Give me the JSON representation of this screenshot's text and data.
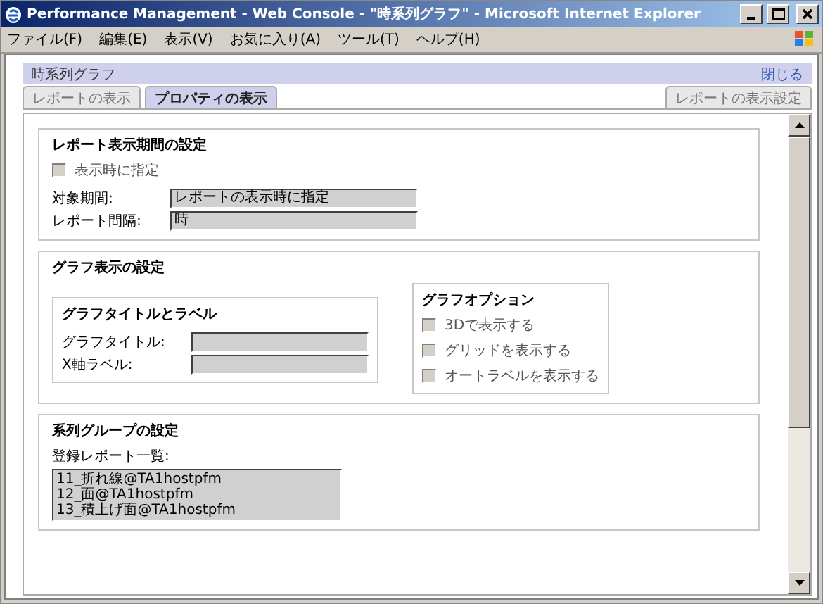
{
  "window": {
    "title": "Performance Management - Web Console - \"時系列グラフ\" - Microsoft Internet Explorer"
  },
  "menu": [
    "ファイル(F)",
    "編集(E)",
    "表示(V)",
    "お気に入り(A)",
    "ツール(T)",
    "ヘルプ(H)"
  ],
  "panel": {
    "title": "時系列グラフ",
    "close_link": "閉じる"
  },
  "tabs": [
    {
      "label": "レポートの表示",
      "selected": false
    },
    {
      "label": "プロパティの表示",
      "selected": true
    }
  ],
  "right_tab": {
    "label": "レポートの表示設定",
    "selected": false
  },
  "period_section": {
    "title": "レポート表示期間の設定",
    "checkbox": {
      "label": "表示時に指定",
      "checked": false,
      "disabled": true
    },
    "fields": [
      {
        "label": "対象期間:",
        "value": "レポートの表示時に指定",
        "disabled": true
      },
      {
        "label": "レポート間隔:",
        "value": "時",
        "disabled": true
      }
    ]
  },
  "graph_section": {
    "title": "グラフ表示の設定",
    "title_label_group": {
      "title": "グラフタイトルとラベル",
      "fields": [
        {
          "label": "グラフタイトル:",
          "disabled": true
        },
        {
          "label": "X軸ラベル:",
          "disabled": true
        }
      ]
    },
    "options_group": {
      "title": "グラフオプション",
      "options": [
        {
          "label": "3Dで表示する",
          "checked": false,
          "disabled": true
        },
        {
          "label": "グリッドを表示する",
          "checked": false,
          "disabled": true
        },
        {
          "label": "オートラベルを表示する",
          "checked": false,
          "disabled": true
        }
      ]
    }
  },
  "series_section": {
    "title": "系列グループの設定",
    "list_label": "登録レポート一覧:",
    "items": [
      "11_折れ線@TA1hostpfm",
      "12_面@TA1hostpfm",
      "13_積上げ面@TA1hostpfm"
    ]
  }
}
